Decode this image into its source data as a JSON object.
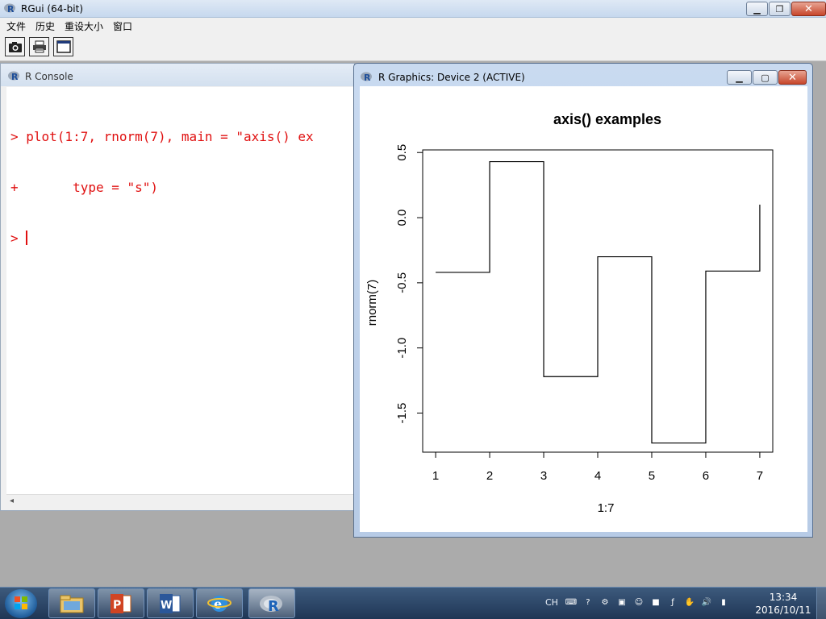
{
  "main_window": {
    "title": "RGui (64-bit)",
    "menu": [
      "文件",
      "历史",
      "重设大小",
      "窗口"
    ],
    "toolbar": [
      "camera-icon",
      "printer-icon",
      "console-window-icon"
    ]
  },
  "console": {
    "title": "R Console",
    "lines": [
      "> plot(1:7, rnorm(7), main = \"axis() ex",
      "+       type = \"s\")",
      "> "
    ],
    "text_color": "#e01010"
  },
  "graphics": {
    "title": "R Graphics: Device 2 (ACTIVE)"
  },
  "chart_data": {
    "type": "line",
    "step": "s",
    "title": "axis() examples",
    "xlabel": "1:7",
    "ylabel": "rnorm(7)",
    "x": [
      1,
      2,
      3,
      4,
      5,
      6,
      7
    ],
    "y": [
      -0.42,
      0.43,
      -1.22,
      -0.3,
      -1.73,
      -0.41,
      0.1
    ],
    "xlim": [
      0.76,
      7.24
    ],
    "ylim": [
      -1.8,
      0.52
    ],
    "xticks": [
      "1",
      "2",
      "3",
      "4",
      "5",
      "6",
      "7"
    ],
    "yticks": [
      0.5,
      0.0,
      -0.5,
      -1.0,
      -1.5
    ],
    "yticks_labels": [
      "0.5",
      "0.0",
      "-0.5",
      "-1.0",
      "-1.5"
    ],
    "grid": false,
    "line_color": "#000000"
  },
  "taskbar": {
    "apps": [
      "file-explorer-icon",
      "powerpoint-icon",
      "word-icon",
      "internet-explorer-icon",
      "r-icon"
    ],
    "lang": "CH",
    "time": "13:34",
    "date": "2016/10/11"
  }
}
